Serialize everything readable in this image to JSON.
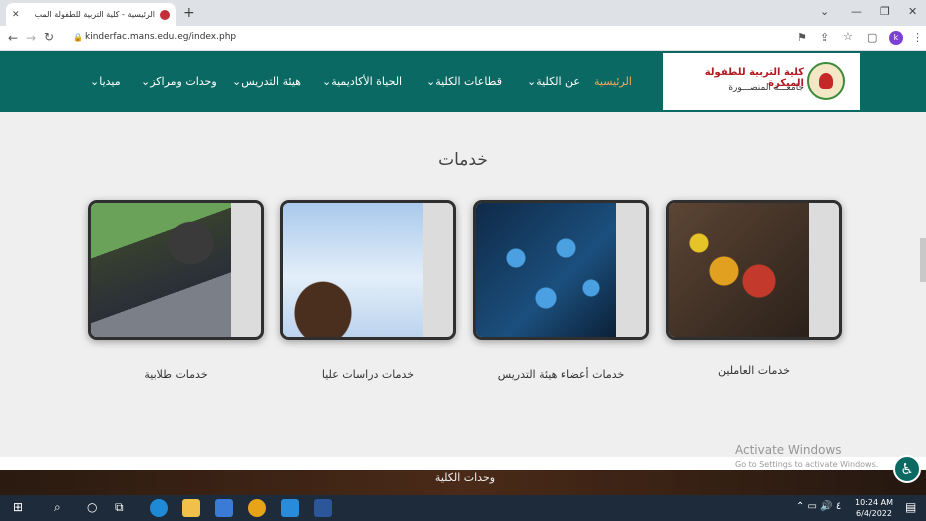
{
  "browser": {
    "tab_title": "الرئيسية - كلية التربية للطفولة المب",
    "url": "kinderfac.mans.edu.eg/index.php",
    "profile_initial": "k"
  },
  "site": {
    "name": "كلية التربية للطفولة المبكرة",
    "university": "جامعـــة المنصـــورة",
    "nav": [
      "الرئيسية",
      "عن الكلية",
      "قطاعات الكلية",
      "الحياة الأكاديمية",
      "هيئة التدريس",
      "وحدات ومراكز",
      "ميديا"
    ]
  },
  "services": {
    "title": "خدمات",
    "cards": [
      "خدمات العاملين",
      "خدمات أعضاء هيئة التدريس",
      "خدمات دراسات عليا",
      "خدمات طلابية"
    ]
  },
  "band_title": "وحدات الكلية",
  "watermark": {
    "line1": "Activate Windows",
    "line2": "Go to Settings to activate Windows."
  },
  "taskbar": {
    "time": "10:24 AM",
    "date": "6/4/2022"
  },
  "colors": {
    "header": "#0a6a63",
    "active_nav": "#f5a55a",
    "logo_red": "#b3181f"
  }
}
